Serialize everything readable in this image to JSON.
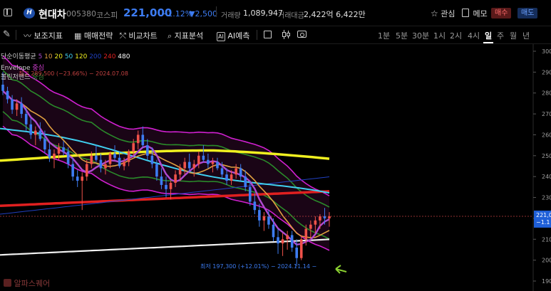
{
  "stock": {
    "name": "현대차",
    "code": "005380",
    "market": "코스피",
    "price": "221,000",
    "change_pct": "−1.12%",
    "change_amt": "▼2,500",
    "volume_label": "거래량",
    "volume": "1,089,947",
    "amount_label": "거래대금",
    "amount": "2,422억 6,422만"
  },
  "actions": {
    "watch": "관심",
    "memo": "메모",
    "buy": "매수",
    "sell": "매도"
  },
  "toolbar": {
    "indicators": "보조지표",
    "strategy": "매매전략",
    "compare": "비교차트",
    "analysis": "지표분석",
    "ai_badge": "AI",
    "ai_predict": "AI예측"
  },
  "timeframes": [
    "1분",
    "5분",
    "30분",
    "1시",
    "2시",
    "4시",
    "일",
    "주",
    "월",
    "년"
  ],
  "active_timeframe": "일",
  "legend": {
    "ma_label": "단순이동평균",
    "ma_periods": [
      {
        "p": "5",
        "color": "#b04ad0"
      },
      {
        "p": "10",
        "color": "#e0a040"
      },
      {
        "p": "20",
        "color": "#f0f020"
      },
      {
        "p": "50",
        "color": "#40d0f0"
      },
      {
        "p": "120",
        "color": "#f0f020"
      },
      {
        "p": "200",
        "color": "#2040c0"
      },
      {
        "p": "240",
        "color": "#e02020"
      },
      {
        "p": "480",
        "color": "#ffffff"
      }
    ],
    "envelope_label": "Envelope",
    "envelope_value": "중심",
    "bollinger_label": "볼린저밴드",
    "bollinger_value": "중심",
    "high_marker": "최고 289,500 (−23.66%) − 2024.07.08"
  },
  "annotations": {
    "low_marker": "최저 197,300 (+12.01%) − 2024.11.14 −"
  },
  "watermark": "알파스퀘어",
  "axis": {
    "ticks": [
      "300",
      "290",
      "280",
      "270",
      "260",
      "250",
      "240",
      "230",
      "220",
      "210",
      "200",
      "190"
    ],
    "current_price_label": "221,0",
    "current_change_label": "−1.1"
  },
  "chart_data": {
    "type": "candlestick",
    "y_unit": "thousand KRW",
    "ylim": [
      187,
      302
    ],
    "candles_ohlc": [
      [
        284,
        290,
        279,
        281
      ],
      [
        281,
        283,
        275,
        277
      ],
      [
        277,
        279,
        270,
        272
      ],
      [
        272,
        277,
        269,
        275
      ],
      [
        275,
        278,
        268,
        270
      ],
      [
        270,
        273,
        262,
        265
      ],
      [
        265,
        268,
        258,
        260
      ],
      [
        260,
        264,
        255,
        262
      ],
      [
        262,
        266,
        257,
        258
      ],
      [
        258,
        262,
        251,
        253
      ],
      [
        253,
        256,
        247,
        249
      ],
      [
        249,
        253,
        244,
        251
      ],
      [
        251,
        256,
        248,
        254
      ],
      [
        254,
        257,
        250,
        252
      ],
      [
        252,
        254,
        244,
        246
      ],
      [
        246,
        249,
        238,
        240
      ],
      [
        240,
        243,
        235,
        238
      ],
      [
        238,
        242,
        224,
        240
      ],
      [
        240,
        248,
        238,
        246
      ],
      [
        246,
        252,
        244,
        250
      ],
      [
        250,
        255,
        247,
        248
      ],
      [
        248,
        251,
        242,
        244
      ],
      [
        244,
        248,
        241,
        246
      ],
      [
        246,
        252,
        244,
        251
      ],
      [
        251,
        255,
        248,
        249
      ],
      [
        249,
        252,
        244,
        245
      ],
      [
        245,
        249,
        243,
        247
      ],
      [
        247,
        253,
        245,
        252
      ],
      [
        252,
        258,
        250,
        256
      ],
      [
        256,
        262,
        253,
        260
      ],
      [
        260,
        264,
        254,
        255
      ],
      [
        255,
        258,
        248,
        250
      ],
      [
        250,
        254,
        244,
        246
      ],
      [
        246,
        248,
        238,
        240
      ],
      [
        240,
        244,
        234,
        236
      ],
      [
        236,
        240,
        230,
        234
      ],
      [
        234,
        238,
        229,
        237
      ],
      [
        237,
        243,
        235,
        241
      ],
      [
        241,
        246,
        238,
        244
      ],
      [
        244,
        249,
        241,
        247
      ],
      [
        247,
        251,
        242,
        244
      ],
      [
        244,
        248,
        240,
        246
      ],
      [
        246,
        252,
        244,
        250
      ],
      [
        250,
        255,
        247,
        248
      ],
      [
        248,
        251,
        244,
        246
      ],
      [
        246,
        249,
        242,
        247
      ],
      [
        247,
        249,
        243,
        244
      ],
      [
        244,
        247,
        239,
        241
      ],
      [
        241,
        244,
        236,
        238
      ],
      [
        238,
        243,
        236,
        241
      ],
      [
        241,
        246,
        239,
        244
      ],
      [
        244,
        246,
        238,
        240
      ],
      [
        240,
        243,
        233,
        235
      ],
      [
        235,
        238,
        226,
        228
      ],
      [
        228,
        232,
        222,
        224
      ],
      [
        224,
        227,
        216,
        219
      ],
      [
        219,
        223,
        214,
        221
      ],
      [
        221,
        224,
        215,
        217
      ],
      [
        217,
        220,
        209,
        211
      ],
      [
        211,
        215,
        203,
        208
      ],
      [
        208,
        213,
        202,
        210
      ],
      [
        210,
        214,
        205,
        212
      ],
      [
        212,
        214,
        204,
        206
      ],
      [
        206,
        210,
        197,
        201
      ],
      [
        201,
        212,
        200,
        210
      ],
      [
        210,
        217,
        207,
        215
      ],
      [
        215,
        219,
        211,
        217
      ],
      [
        217,
        221,
        213,
        219
      ],
      [
        219,
        222,
        215,
        221
      ],
      [
        221,
        225,
        217,
        220
      ],
      [
        220,
        223,
        216,
        221
      ]
    ],
    "moving_averages_visible": [
      "5",
      "10",
      "20",
      "50",
      "120",
      "200",
      "240",
      "480"
    ]
  }
}
